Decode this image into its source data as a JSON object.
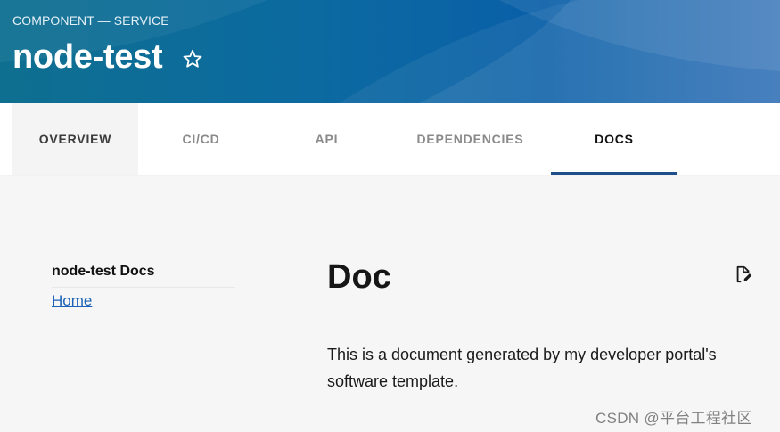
{
  "header": {
    "kicker": "COMPONENT — SERVICE",
    "title": "node-test",
    "favorite_icon": "star-outline-icon"
  },
  "tabs": [
    {
      "label": "OVERVIEW",
      "state": "hovered"
    },
    {
      "label": "CI/CD",
      "state": "default"
    },
    {
      "label": "API",
      "state": "default"
    },
    {
      "label": "DEPENDENCIES",
      "state": "default"
    },
    {
      "label": "DOCS",
      "state": "active"
    }
  ],
  "sidebar": {
    "title": "node-test Docs",
    "links": [
      {
        "label": "Home"
      }
    ]
  },
  "doc": {
    "title": "Doc",
    "edit_icon": "edit-page-icon",
    "body": "This is a document generated by my developer portal's software template."
  },
  "watermark": "CSDN @平台工程社区",
  "colors": {
    "header_primary": "#0a5fa8",
    "tab_underline": "#1f4f8a",
    "link": "#1c63b7",
    "background": "#f6f6f6"
  }
}
